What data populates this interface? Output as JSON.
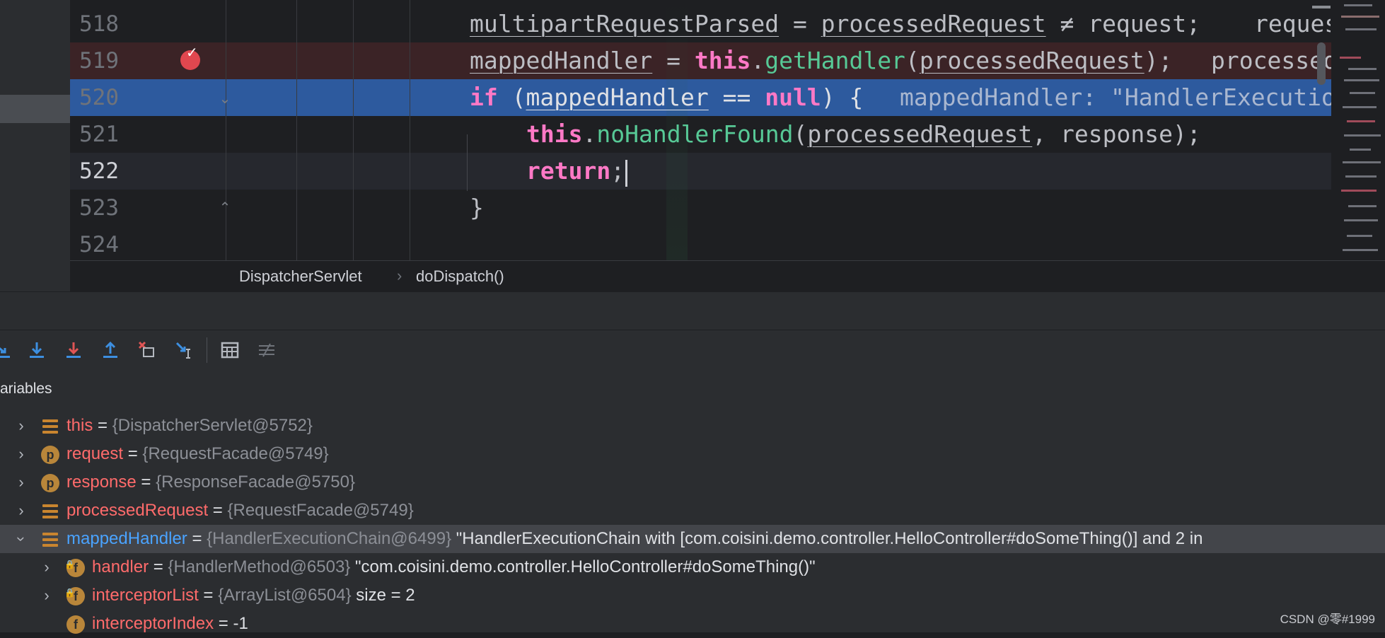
{
  "editor": {
    "lines": [
      {
        "num": "518"
      },
      {
        "num": "519"
      },
      {
        "num": "520"
      },
      {
        "num": "521"
      },
      {
        "num": "522"
      },
      {
        "num": "523"
      },
      {
        "num": "524"
      }
    ],
    "code": {
      "l518": {
        "a": "multipartRequestParsed",
        "b": " = ",
        "c": "processedRequest",
        "d": " ≠ request;",
        "hint": "reques"
      },
      "l519": {
        "a": "mappedHandler",
        "b": " = ",
        "kw": "this",
        "dot": ".",
        "fn": "getHandler",
        "p1": "(",
        "arg": "processedRequest",
        "p2": ");",
        "hint": "processed"
      },
      "l520": {
        "kw": "if",
        "p1": " (",
        "a": "mappedHandler",
        "op": " == ",
        "kw2": "null",
        "p2": ") {",
        "hint": "mappedHandler: \"HandlerExecutio"
      },
      "l521": {
        "kw": "this",
        "dot": ".",
        "fn": "noHandlerFound",
        "p1": "(",
        "a": "processedRequest",
        "p2": ", response);"
      },
      "l522": {
        "kw": "return",
        "p": ";"
      },
      "l523": {
        "brace": "}"
      }
    }
  },
  "breadcrumb": {
    "items": [
      "DispatcherServlet",
      "doDispatch()"
    ],
    "separator": "›"
  },
  "toolbar": {
    "buttons": [
      {
        "icon": "step-over-icon"
      },
      {
        "icon": "step-into-icon"
      },
      {
        "icon": "force-step-into-icon"
      },
      {
        "icon": "step-out-icon"
      },
      {
        "icon": "drop-frame-icon"
      },
      {
        "icon": "run-to-cursor-icon"
      },
      {
        "icon": "evaluate-expression-icon"
      },
      {
        "icon": "trace-current-stream-icon"
      }
    ]
  },
  "variables": {
    "header": "ariables",
    "rows": [
      {
        "name": "this",
        "eq": " = ",
        "ref": "{DispatcherServlet@5752}",
        "val": "",
        "icon": "field-list-icon"
      },
      {
        "name": "request",
        "eq": " = ",
        "ref": "{RequestFacade@5749}",
        "val": "",
        "icon": "parameter-icon",
        "badge": "p"
      },
      {
        "name": "response",
        "eq": " = ",
        "ref": "{ResponseFacade@5750}",
        "val": "",
        "icon": "parameter-icon",
        "badge": "p"
      },
      {
        "name": "processedRequest",
        "eq": " = ",
        "ref": "{RequestFacade@5749}",
        "val": "",
        "icon": "field-list-icon"
      },
      {
        "name": "mappedHandler",
        "eq": " = ",
        "ref": "{HandlerExecutionChain@6499}",
        "val": " \"HandlerExecutionChain with [com.coisini.demo.controller.HelloController#doSomeThing()] and 2 in",
        "icon": "field-list-icon"
      },
      {
        "name": "handler",
        "eq": " = ",
        "ref": "{HandlerMethod@6503}",
        "val": " \"com.coisini.demo.controller.HelloController#doSomeThing()\"",
        "icon": "field-icon",
        "badge": "f"
      },
      {
        "name": "interceptorList",
        "eq": " = ",
        "ref": "{ArrayList@6504}",
        "val": "  size = 2",
        "icon": "field-icon",
        "badge": "f"
      },
      {
        "name": "interceptorIndex",
        "eq": " = ",
        "ref": "",
        "val": "-1",
        "icon": "field-icon",
        "badge": "f"
      }
    ]
  },
  "watermark": "CSDN @零#1999",
  "colors": {
    "background": "#1e1f22",
    "panel": "#2b2d30",
    "execution_line": "#2d5a9e",
    "breakpoint": "#e0474f",
    "keyword": "#ff79c6",
    "method": "#57c996",
    "variable_name": "#ff6b6b",
    "selected_name": "#4aa3ff"
  }
}
